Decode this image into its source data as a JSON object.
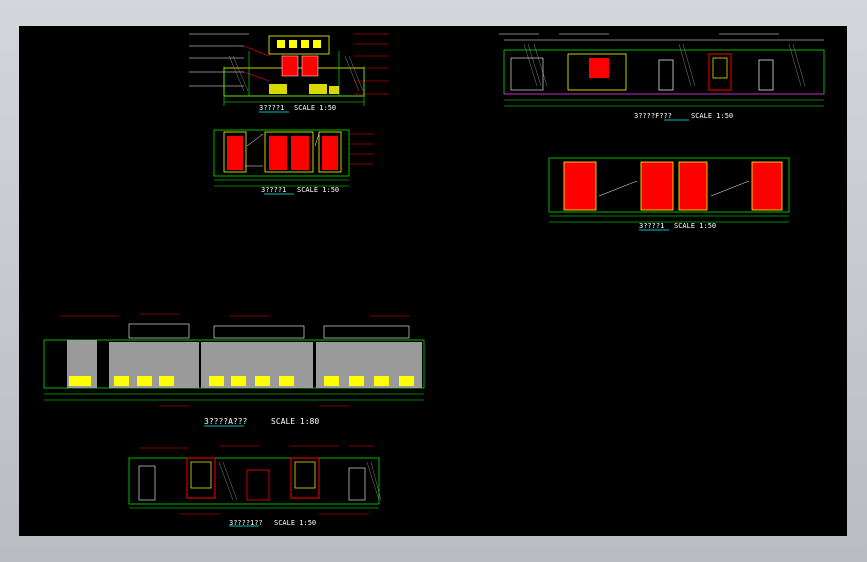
{
  "colors": {
    "background": "#000000",
    "frame": "#c9ccd1",
    "red": "#ff0000",
    "yellow": "#ffff00",
    "green": "#00ff00",
    "cyan": "#00ffff",
    "white": "#ffffff",
    "magenta": "#ff00ff",
    "gray": "#808080"
  },
  "drawings": [
    {
      "id": "elevation-top-left",
      "title": "3????1",
      "scale": "SCALE 1:50"
    },
    {
      "id": "elevation-mid-left",
      "title": "3????1",
      "scale": "SCALE 1:50"
    },
    {
      "id": "elevation-top-right",
      "title": "3????F???",
      "scale": "SCALE 1:50"
    },
    {
      "id": "elevation-mid-right",
      "title": "3????1",
      "scale": "SCALE 1:50"
    },
    {
      "id": "elevation-long",
      "title": "3????A???",
      "scale": "SCALE 1:80"
    },
    {
      "id": "elevation-bottom",
      "title": "3????1??",
      "scale": "SCALE 1:50"
    }
  ]
}
